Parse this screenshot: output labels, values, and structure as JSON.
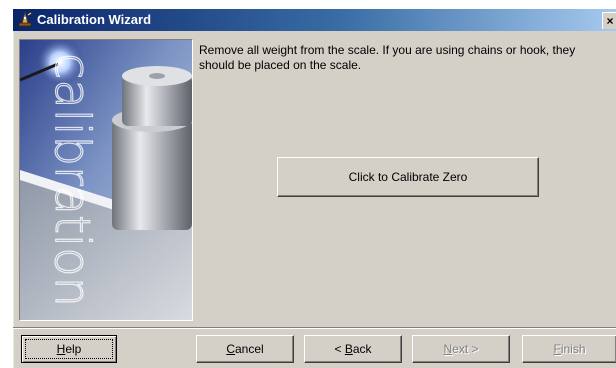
{
  "window": {
    "title": "Calibration Wizard",
    "close_glyph": "×"
  },
  "side_panel": {
    "watermark": "calibration"
  },
  "instruction": "Remove all weight from the scale. If you are using chains or hook, they should be placed on the scale.",
  "calibrate_button": "Click to Calibrate Zero",
  "buttons": {
    "help": {
      "pre": "",
      "key": "H",
      "post": "elp"
    },
    "cancel": {
      "pre": "",
      "key": "C",
      "post": "ancel"
    },
    "back": {
      "pre": "< ",
      "key": "B",
      "post": "ack"
    },
    "next": {
      "pre": "",
      "key": "N",
      "post": "ext >"
    },
    "finish": {
      "pre": "",
      "key": "F",
      "post": "inish"
    }
  },
  "colors": {
    "title_start": "#0a246a",
    "title_end": "#a6caf0",
    "face": "#d4d0c8",
    "disabled_text": "#808080"
  }
}
